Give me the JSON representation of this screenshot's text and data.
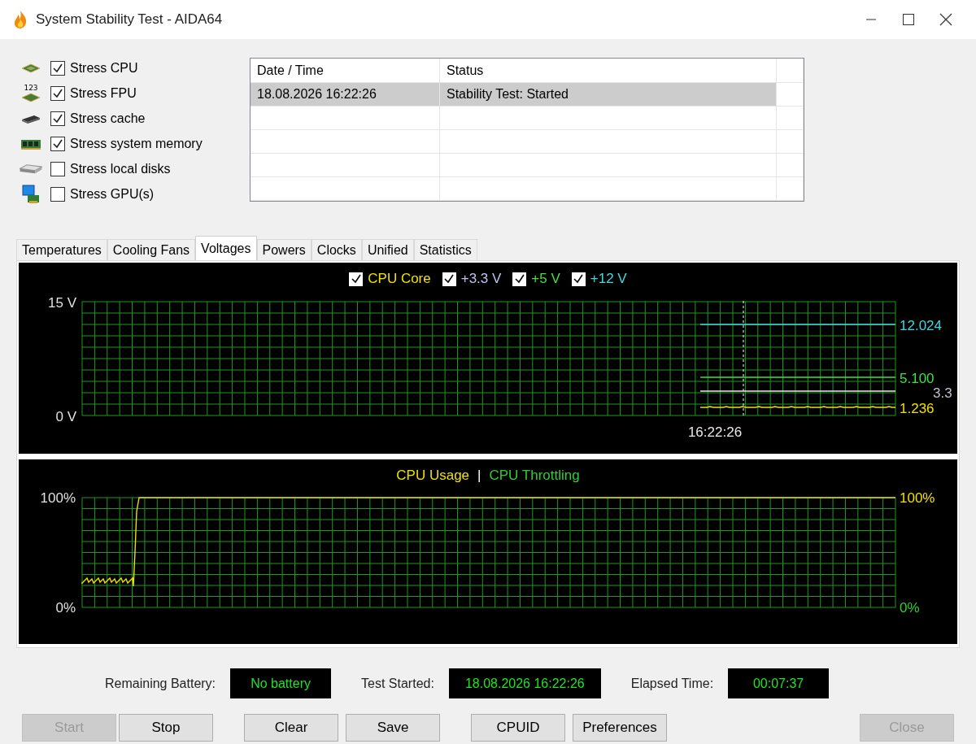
{
  "window": {
    "title": "System Stability Test - AIDA64"
  },
  "stress_options": [
    {
      "kind": "cpu",
      "label": "Stress CPU",
      "checked": true
    },
    {
      "kind": "fpu",
      "icon_text": "123",
      "label": "Stress FPU",
      "checked": true
    },
    {
      "kind": "cache",
      "label": "Stress cache",
      "checked": true
    },
    {
      "kind": "memory",
      "label": "Stress system memory",
      "checked": true
    },
    {
      "kind": "disk",
      "label": "Stress local disks",
      "checked": false
    },
    {
      "kind": "gpu",
      "label": "Stress GPU(s)",
      "checked": false
    }
  ],
  "log": {
    "columns": [
      "Date / Time",
      "Status"
    ],
    "rows": [
      {
        "cells": [
          "18.08.2026 16:22:26",
          "Stability Test: Started"
        ],
        "selected": true
      }
    ]
  },
  "tabs": [
    {
      "label": "Temperatures",
      "selected": false
    },
    {
      "label": "Cooling Fans",
      "selected": false
    },
    {
      "label": "Voltages",
      "selected": true
    },
    {
      "label": "Powers",
      "selected": false
    },
    {
      "label": "Clocks",
      "selected": false
    },
    {
      "label": "Unified",
      "selected": false
    },
    {
      "label": "Statistics",
      "selected": false
    }
  ],
  "voltage_graph": {
    "legend": [
      {
        "label": "CPU Core",
        "checked": true,
        "color": "#f0e000"
      },
      {
        "label": "+3.3 V",
        "checked": true,
        "color": "#c0c0f0"
      },
      {
        "label": "+5 V",
        "checked": true,
        "color": "#40e040"
      },
      {
        "label": "+12 V",
        "checked": true,
        "color": "#40d8e0"
      }
    ],
    "y_max": "15 V",
    "y_min": "0 V",
    "time": "16:22:26",
    "readings": [
      {
        "text": "12.024",
        "color": "#40d8e0"
      },
      {
        "text": "5.100",
        "color": "#40e040"
      },
      {
        "text": "3.3",
        "color": "#c0c0d0"
      },
      {
        "text": "1.236",
        "color": "#f0e000"
      }
    ]
  },
  "usage_graph": {
    "legend": [
      {
        "label": "CPU Usage",
        "color": "#f0e000"
      },
      {
        "label": "CPU Throttling",
        "color": "#30d030"
      }
    ],
    "separator": "|",
    "left_max": "100%",
    "left_min": "0%",
    "right_max": "100%",
    "right_min": "0%"
  },
  "status": [
    {
      "label": "Remaining Battery:",
      "value": "No battery"
    },
    {
      "label": "Test Started:",
      "value": "18.08.2026 16:22:26"
    },
    {
      "label": "Elapsed Time:",
      "value": "00:07:37"
    }
  ],
  "buttons": [
    {
      "label": "Start",
      "disabled": true
    },
    {
      "label": "Stop",
      "disabled": false
    },
    {
      "label": "Clear",
      "disabled": false
    },
    {
      "label": "Save",
      "disabled": false
    },
    {
      "label": "CPUID",
      "disabled": false
    },
    {
      "label": "Preferences",
      "disabled": false
    },
    {
      "label": "Close",
      "disabled": true
    }
  ]
}
